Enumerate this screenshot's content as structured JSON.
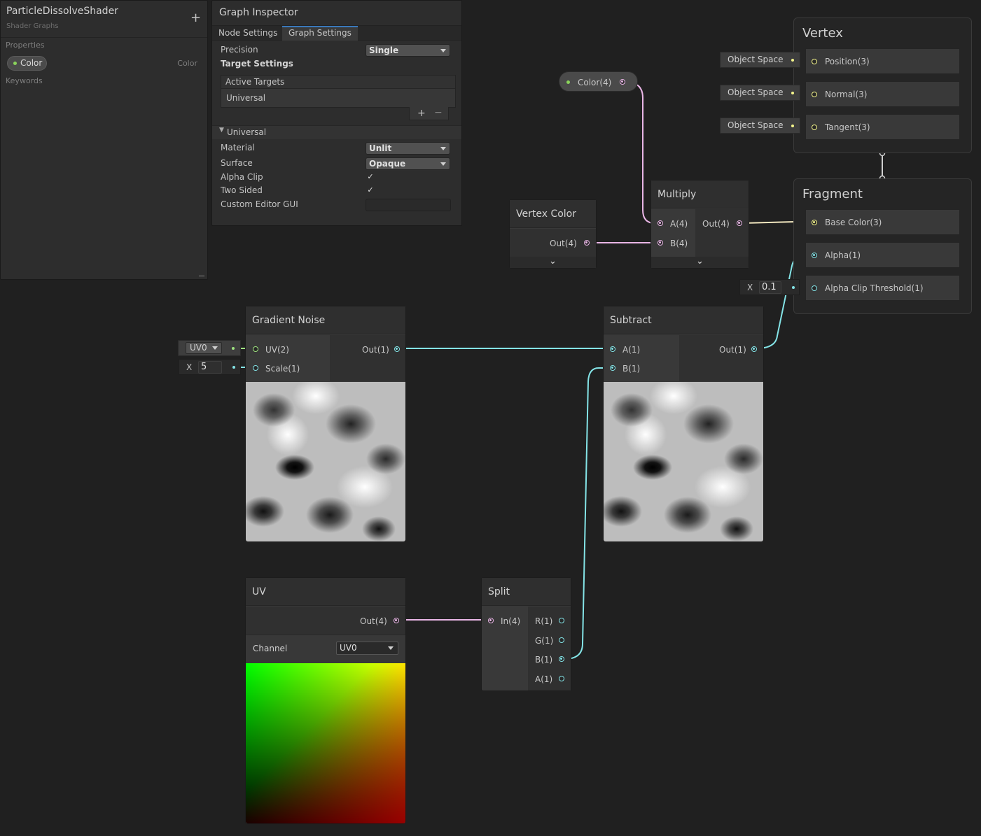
{
  "blackboard": {
    "title": "ParticleDissolveShader",
    "subtitle": "Shader Graphs",
    "add_label": "+",
    "properties_label": "Properties",
    "property": {
      "name": "Color",
      "type": "Color"
    },
    "keywords_label": "Keywords"
  },
  "inspector": {
    "title": "Graph Inspector",
    "tabs": [
      "Node Settings",
      "Graph Settings"
    ],
    "active_tab": "Graph Settings",
    "precision_label": "Precision",
    "precision_value": "Single",
    "target_settings_label": "Target Settings",
    "active_targets_label": "Active Targets",
    "target_item": "Universal",
    "add_label": "+",
    "remove_label": "−",
    "universal_section": "Universal",
    "material_label": "Material",
    "material_value": "Unlit",
    "surface_label": "Surface",
    "surface_value": "Opaque",
    "alpha_clip_label": "Alpha Clip",
    "alpha_clip": true,
    "two_sided_label": "Two Sided",
    "two_sided": true,
    "custom_gui_label": "Custom Editor GUI",
    "custom_gui_value": ""
  },
  "nodes": {
    "color_prop": {
      "label": "Color(4)"
    },
    "vertex_color": {
      "title": "Vertex Color",
      "out": "Out(4)"
    },
    "multiply": {
      "title": "Multiply",
      "in_a": "A(4)",
      "in_b": "B(4)",
      "out": "Out(4)"
    },
    "gradient_noise": {
      "title": "Gradient Noise",
      "in_uv": "UV(2)",
      "in_scale": "Scale(1)",
      "out": "Out(1)",
      "uv_default": "UV0",
      "scale_x": "X",
      "scale_value": "5"
    },
    "subtract": {
      "title": "Subtract",
      "in_a": "A(1)",
      "in_b": "B(1)",
      "out": "Out(1)"
    },
    "uv": {
      "title": "UV",
      "out": "Out(4)",
      "channel_label": "Channel",
      "channel_value": "UV0"
    },
    "split": {
      "title": "Split",
      "in": "In(4)",
      "out_r": "R(1)",
      "out_g": "G(1)",
      "out_b": "B(1)",
      "out_a": "A(1)"
    }
  },
  "vertex": {
    "title": "Vertex",
    "blocks": [
      {
        "label": "Position(3)",
        "space": "Object Space"
      },
      {
        "label": "Normal(3)",
        "space": "Object Space"
      },
      {
        "label": "Tangent(3)",
        "space": "Object Space"
      }
    ]
  },
  "fragment": {
    "title": "Fragment",
    "blocks": [
      {
        "label": "Base Color(3)"
      },
      {
        "label": "Alpha(1)"
      },
      {
        "label": "Alpha Clip Threshold(1)"
      }
    ],
    "threshold_x": "X",
    "threshold_value": "0.1"
  },
  "colors": {
    "vector4": "#e9b6e6",
    "vector1": "#84e4e7",
    "vector3": "#f3f48b",
    "vector2": "#9ee37f",
    "tab_accent": "#3a79bb"
  }
}
